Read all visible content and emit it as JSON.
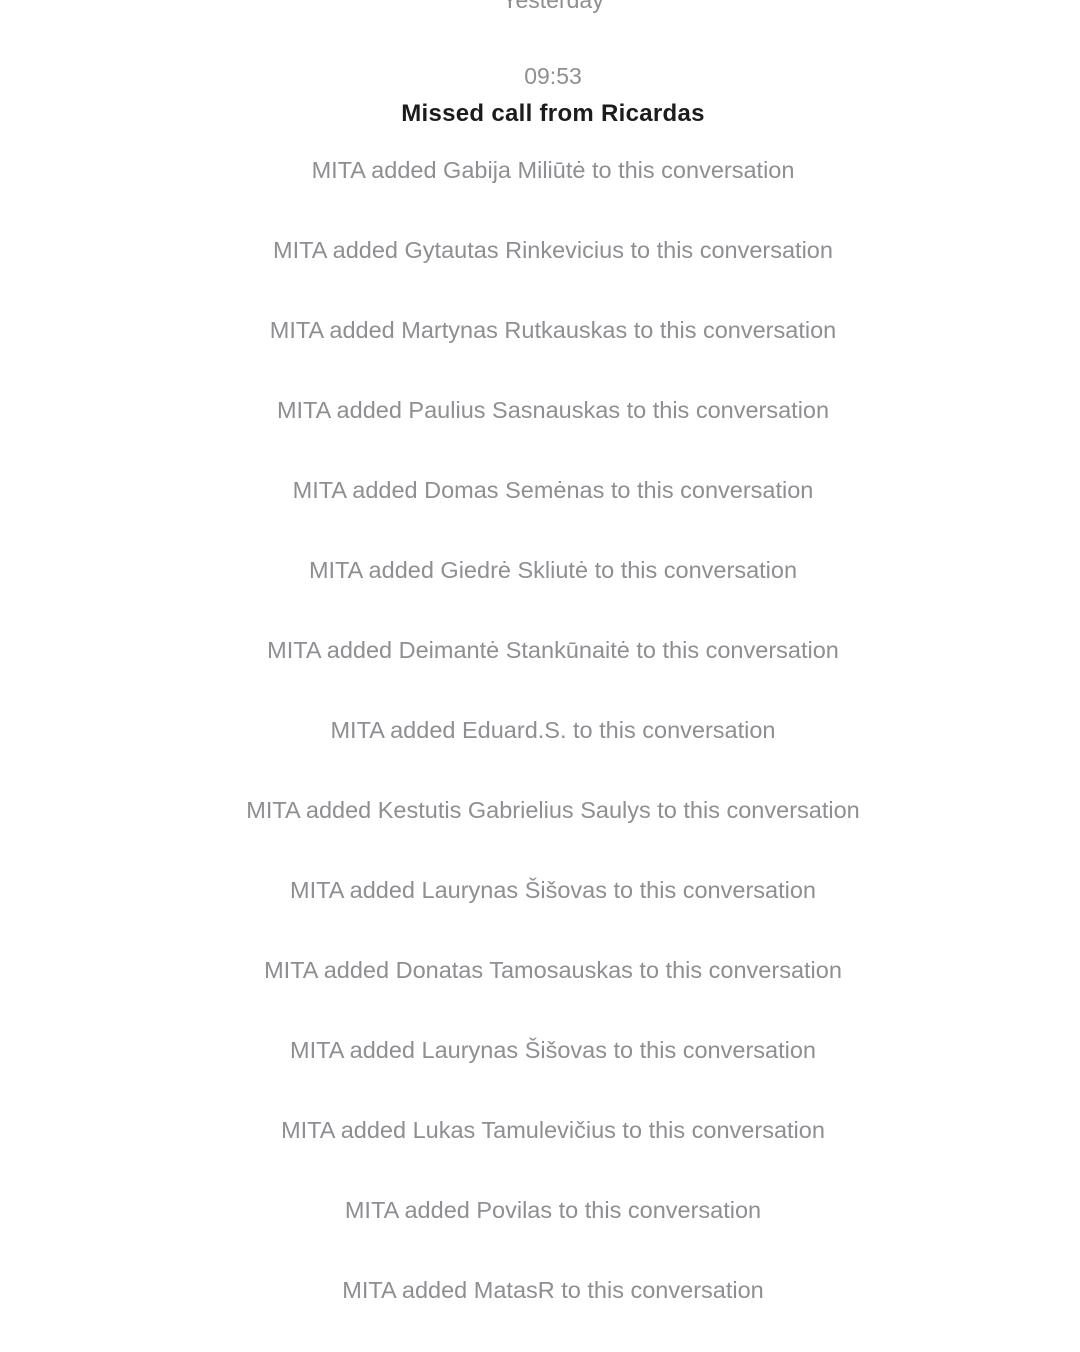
{
  "conversation": {
    "day_separator": "Yesterday",
    "time": "09:53",
    "missed_call": "Missed call from Ricardas",
    "events": [
      "MITA added Gabija Miliūtė to this conversation",
      "MITA added Gytautas Rinkevicius to this conversation",
      "MITA added Martynas Rutkauskas to this conversation",
      "MITA added Paulius Sasnauskas to this conversation",
      "MITA added Domas Semėnas to this conversation",
      "MITA added Giedrė Skliutė to this conversation",
      "MITA added Deimantė Stankūnaitė to this conversation",
      "MITA added Eduard.S. to this conversation",
      "MITA added Kestutis Gabrielius Saulys to this conversation",
      "MITA added Laurynas Šišovas to this conversation",
      "MITA added Donatas Tamosauskas to this conversation",
      "MITA added Laurynas Šišovas to this conversation",
      "MITA added Lukas Tamulevičius to this conversation",
      "MITA added Povilas to this conversation",
      "MITA added MatasR to this conversation"
    ]
  }
}
